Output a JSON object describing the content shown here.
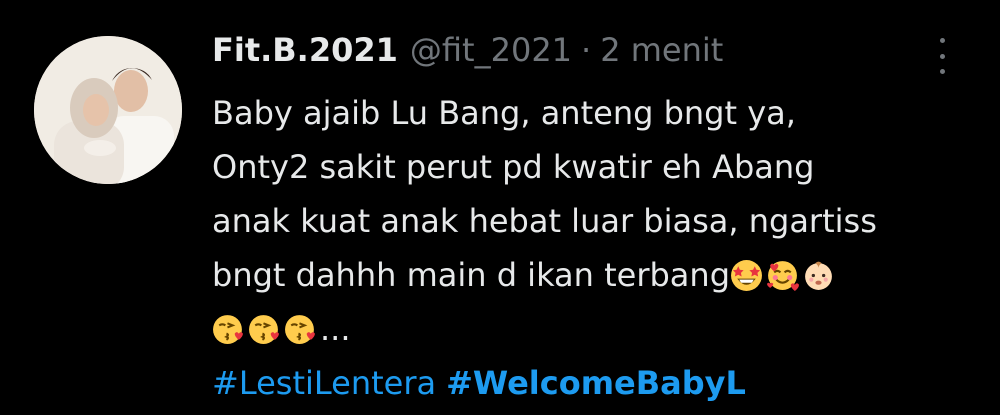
{
  "tweet": {
    "display_name": "Fit.B.2021",
    "handle": "@fit_2021",
    "separator": "·",
    "time": "2 menit",
    "lines": [
      "Baby ajaib Lu Bang, anteng bngt ya,",
      "Onty2 sakit perut pd kwatir eh Abang",
      "anak kuat anak hebat luar biasa, ngartiss",
      "bngt dahhh main d ikan terbang"
    ],
    "line5_suffix": "...",
    "emojis_line4": [
      "star-struck-emoji",
      "smiling-hearts-emoji",
      "baby-emoji"
    ],
    "emojis_line5": [
      "kissing-heart-emoji",
      "kissing-heart-emoji",
      "kissing-heart-emoji"
    ],
    "hashtags": [
      "#LestiLentera",
      "#WelcomeBabyL"
    ]
  },
  "colors": {
    "background": "#000000",
    "text": "#e7e9ea",
    "muted": "#71767b",
    "link": "#1d9bf0"
  }
}
